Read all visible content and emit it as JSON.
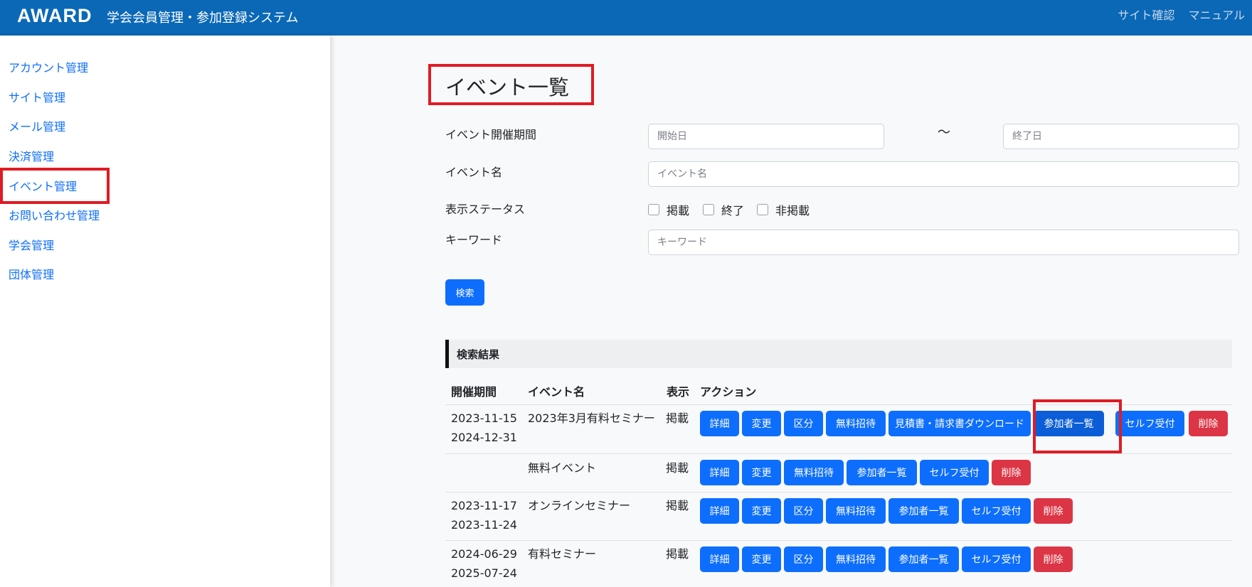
{
  "header": {
    "logo": "AWARD",
    "title": "学会会員管理・参加登録システム",
    "links": [
      "サイト確認",
      "マニュアル"
    ]
  },
  "sidebar": {
    "items": [
      "アカウント管理",
      "サイト管理",
      "メール管理",
      "決済管理",
      "イベント管理",
      "お問い合わせ管理",
      "学会管理",
      "団体管理"
    ]
  },
  "page": {
    "title": "イベント一覧"
  },
  "form": {
    "period_label": "イベント開催期間",
    "start_placeholder": "開始日",
    "tilde": "〜",
    "end_placeholder": "終了日",
    "name_label": "イベント名",
    "name_placeholder": "イベント名",
    "status_label": "表示ステータス",
    "status_options": [
      "掲載",
      "終了",
      "非掲載"
    ],
    "keyword_label": "キーワード",
    "keyword_placeholder": "キーワード",
    "search_button": "検索"
  },
  "results": {
    "title": "検索結果",
    "columns": [
      "開催期間",
      "イベント名",
      "表示",
      "アクション"
    ],
    "rows": [
      {
        "start": "2023-11-15",
        "end": "2024-12-31",
        "name": "2023年3月有料セミナー",
        "status": "掲載",
        "actions": [
          "詳細",
          "変更",
          "区分",
          "無料招待",
          "見積書・請求書ダウンロード",
          "参加者一覧",
          "セルフ受付",
          "削除"
        ]
      },
      {
        "start": "",
        "end": "",
        "name": "無料イベント",
        "status": "掲載",
        "actions": [
          "詳細",
          "変更",
          "無料招待",
          "参加者一覧",
          "セルフ受付",
          "削除"
        ]
      },
      {
        "start": "2023-11-17",
        "end": "2023-11-24",
        "name": "オンラインセミナー",
        "status": "掲載",
        "actions": [
          "詳細",
          "変更",
          "区分",
          "無料招待",
          "参加者一覧",
          "セルフ受付",
          "削除"
        ]
      },
      {
        "start": "2024-06-29",
        "end": "2025-07-24",
        "name": "有料セミナー",
        "status": "掲載",
        "actions": [
          "詳細",
          "変更",
          "区分",
          "無料招待",
          "参加者一覧",
          "セルフ受付",
          "削除"
        ]
      }
    ]
  },
  "colors": {
    "header": "#0a68b7",
    "primary": "#0d6efd",
    "danger": "#dc3545",
    "highlight": "#e01b24"
  }
}
